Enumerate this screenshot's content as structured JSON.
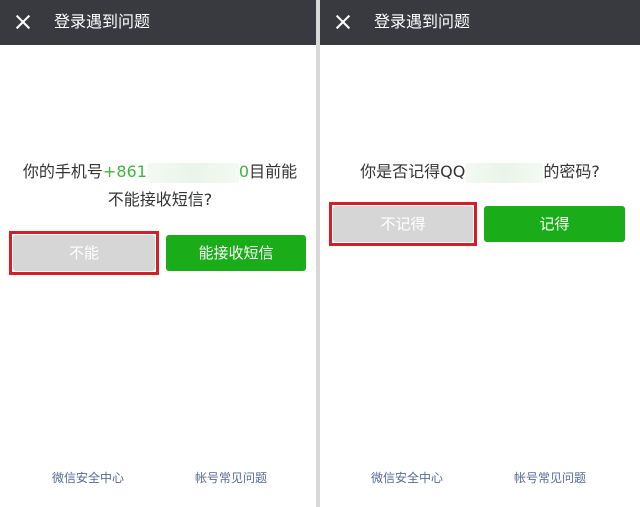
{
  "screens": [
    {
      "title": "登录遇到问题",
      "question_line1_prefix": "你的手机号",
      "phone_prefix": "+861",
      "phone_suffix": "0",
      "question_line1_suffix": "目前能",
      "question_line2": "不能接收短信?",
      "button_no": "不能",
      "button_yes": "能接收短信",
      "link_left": "微信安全中心",
      "link_right": "帐号常见问题"
    },
    {
      "title": "登录遇到问题",
      "question_prefix": "你是否记得QQ",
      "question_suffix": "的密码?",
      "button_no": "不记得",
      "button_yes": "记得",
      "link_left": "微信安全中心",
      "link_right": "帐号常见问题"
    }
  ],
  "colors": {
    "titlebar": "#393a3f",
    "primary_green": "#1aad19",
    "phone_green": "#3fb53f",
    "grey_button": "#d6d6d6",
    "highlight_red": "#d32027",
    "link_blue": "#576b95"
  },
  "icons": {
    "close": "close-icon"
  }
}
